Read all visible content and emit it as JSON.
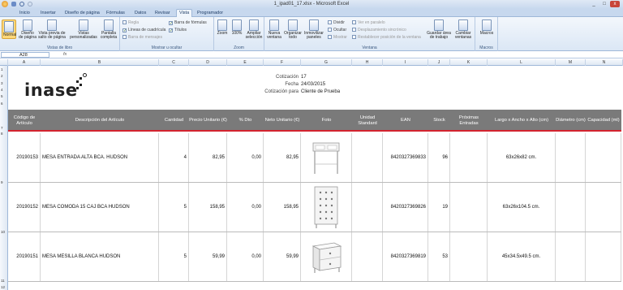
{
  "window": {
    "title": "1_ipad01_17.xlsx - Microsoft Excel"
  },
  "ribbon_tabs": [
    "Inicio",
    "Insertar",
    "Diseño de página",
    "Fórmulas",
    "Datos",
    "Revisar",
    "Vista",
    "Programador"
  ],
  "active_tab": "Vista",
  "ribbon": {
    "vistas": {
      "label": "Vistas de libro",
      "buttons": [
        "Normal",
        "Diseño de página",
        "Vista previa de salto de página",
        "Vistas personalizadas",
        "Pantalla completa"
      ]
    },
    "mostrar": {
      "label": "Mostrar u ocultar",
      "options": [
        {
          "text": "Regla",
          "checked": false,
          "disabled": true
        },
        {
          "text": "Líneas de cuadrícula",
          "checked": true,
          "disabled": false
        },
        {
          "text": "Barra de mensajes",
          "checked": false,
          "disabled": true
        },
        {
          "text": "Barra de fórmulas",
          "checked": true,
          "disabled": false
        },
        {
          "text": "Títulos",
          "checked": true,
          "disabled": false
        }
      ]
    },
    "zoom": {
      "label": "Zoom",
      "buttons": [
        "Zoom",
        "100%",
        "Ampliar selección"
      ]
    },
    "ventana": {
      "label": "Ventana",
      "buttons": [
        "Nueva ventana",
        "Organizar todo",
        "Inmovilizar paneles"
      ],
      "small": [
        "Dividir",
        "Ocultar",
        "Mostrar"
      ],
      "small2": [
        "Ver en paralelo",
        "Desplazamiento sincrónico",
        "Restablecer posición de la ventana"
      ],
      "extra": [
        "Guardar área de trabajo",
        "Cambiar ventanas"
      ]
    },
    "macros": {
      "label": "Macros",
      "buttons": [
        "Macros"
      ]
    }
  },
  "formula_bar": {
    "name_box": "A28",
    "fx": "fx",
    "content": ""
  },
  "columns": [
    "A",
    "B",
    "C",
    "D",
    "E",
    "F",
    "G",
    "H",
    "I",
    "J",
    "K",
    "L",
    "M",
    "N"
  ],
  "rows": [
    "1",
    "2",
    "3",
    "4",
    "5",
    "6",
    "7",
    "8",
    "9",
    "10",
    "11",
    "12"
  ],
  "logo": {
    "text": "inase"
  },
  "info": [
    {
      "label": "Cotización",
      "value": "17"
    },
    {
      "label": "Fecha",
      "value": "24/03/2015"
    },
    {
      "label": "Cotización para",
      "value": "Cliente de Prueba"
    }
  ],
  "table": {
    "headers": [
      "Código de Artículo",
      "Descripción del Artículo",
      "Cantidad",
      "Precio Unitario (€)",
      "% Dto",
      "Neto Unitario (€)",
      "Foto",
      "Unidad Standard",
      "EAN",
      "Stock",
      "Próximas Entradas",
      "Largo x Ancho x Alto (cm)",
      "Diámetro (cm)",
      "Capacidad (ml)"
    ],
    "rows": [
      {
        "codigo": "20190153",
        "descripcion": "MESA ENTRADA ALTA BCA. HUDSON",
        "cantidad": "4",
        "precio": "82,95",
        "dto": "0,00",
        "neto": "82,95",
        "foto": "console-table-icon",
        "unidad": "",
        "ean": "8420327369833",
        "stock": "96",
        "proximas": "",
        "medidas": "63x26x82 cm.",
        "diametro": "",
        "capacidad": ""
      },
      {
        "codigo": "20190152",
        "descripcion": "MESA COMODA 15 CAJ BCA HUDSON",
        "cantidad": "5",
        "precio": "158,95",
        "dto": "0,00",
        "neto": "158,95",
        "foto": "chest-of-drawers-icon",
        "unidad": "",
        "ean": "8420327369826",
        "stock": "19",
        "proximas": "",
        "medidas": "63x26x104.5 cm.",
        "diametro": "",
        "capacidad": ""
      },
      {
        "codigo": "20190151",
        "descripcion": "MESA MESILLA BLANCA HUDSON",
        "cantidad": "5",
        "precio": "59,99",
        "dto": "0,00",
        "neto": "59,99",
        "foto": "nightstand-icon",
        "unidad": "",
        "ean": "8420327369819",
        "stock": "53",
        "proximas": "",
        "medidas": "45x34.5x49.5 cm.",
        "diametro": "",
        "capacidad": ""
      }
    ]
  }
}
